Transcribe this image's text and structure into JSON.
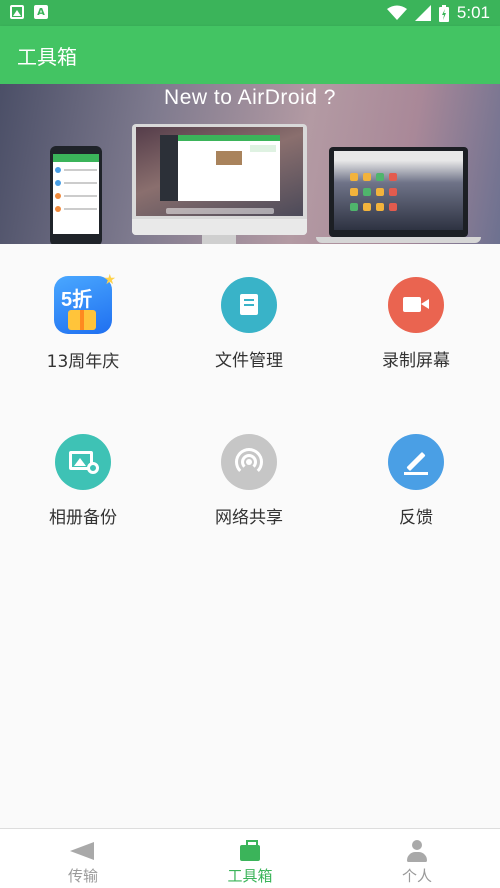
{
  "status_bar": {
    "time": "5:01",
    "left_icons": [
      "image-notification-icon",
      "a-notification-icon"
    ],
    "right_icons": [
      "wifi-icon",
      "cellular-signal-icon",
      "battery-charging-icon"
    ]
  },
  "app_bar": {
    "title": "工具箱"
  },
  "banner": {
    "title": "New to AirDroid ?",
    "page_count": 1,
    "active_page": 0
  },
  "tools": [
    {
      "label": "13周年庆",
      "icon": "promo-5-discount-icon",
      "promo_text": "5折"
    },
    {
      "label": "文件管理",
      "icon": "file-manager-icon",
      "color": "#39b3c8"
    },
    {
      "label": "录制屏幕",
      "icon": "screen-record-icon",
      "color": "#ea6450"
    },
    {
      "label": "相册备份",
      "icon": "photo-backup-icon",
      "color": "#3ec2b5"
    },
    {
      "label": "网络共享",
      "icon": "network-share-icon",
      "color": "#c6c6c6"
    },
    {
      "label": "反馈",
      "icon": "feedback-icon",
      "color": "#4a9fe5"
    }
  ],
  "bottom_nav": {
    "items": [
      {
        "label": "传输",
        "icon": "send-plane-icon"
      },
      {
        "label": "工具箱",
        "icon": "toolbox-icon"
      },
      {
        "label": "个人",
        "icon": "person-icon"
      }
    ],
    "active": "工具箱"
  },
  "colors": {
    "primary": "#43c463",
    "status_bar": "#3bb45a",
    "nav_active": "#3bb45a",
    "nav_inactive": "#9a9a9a"
  }
}
